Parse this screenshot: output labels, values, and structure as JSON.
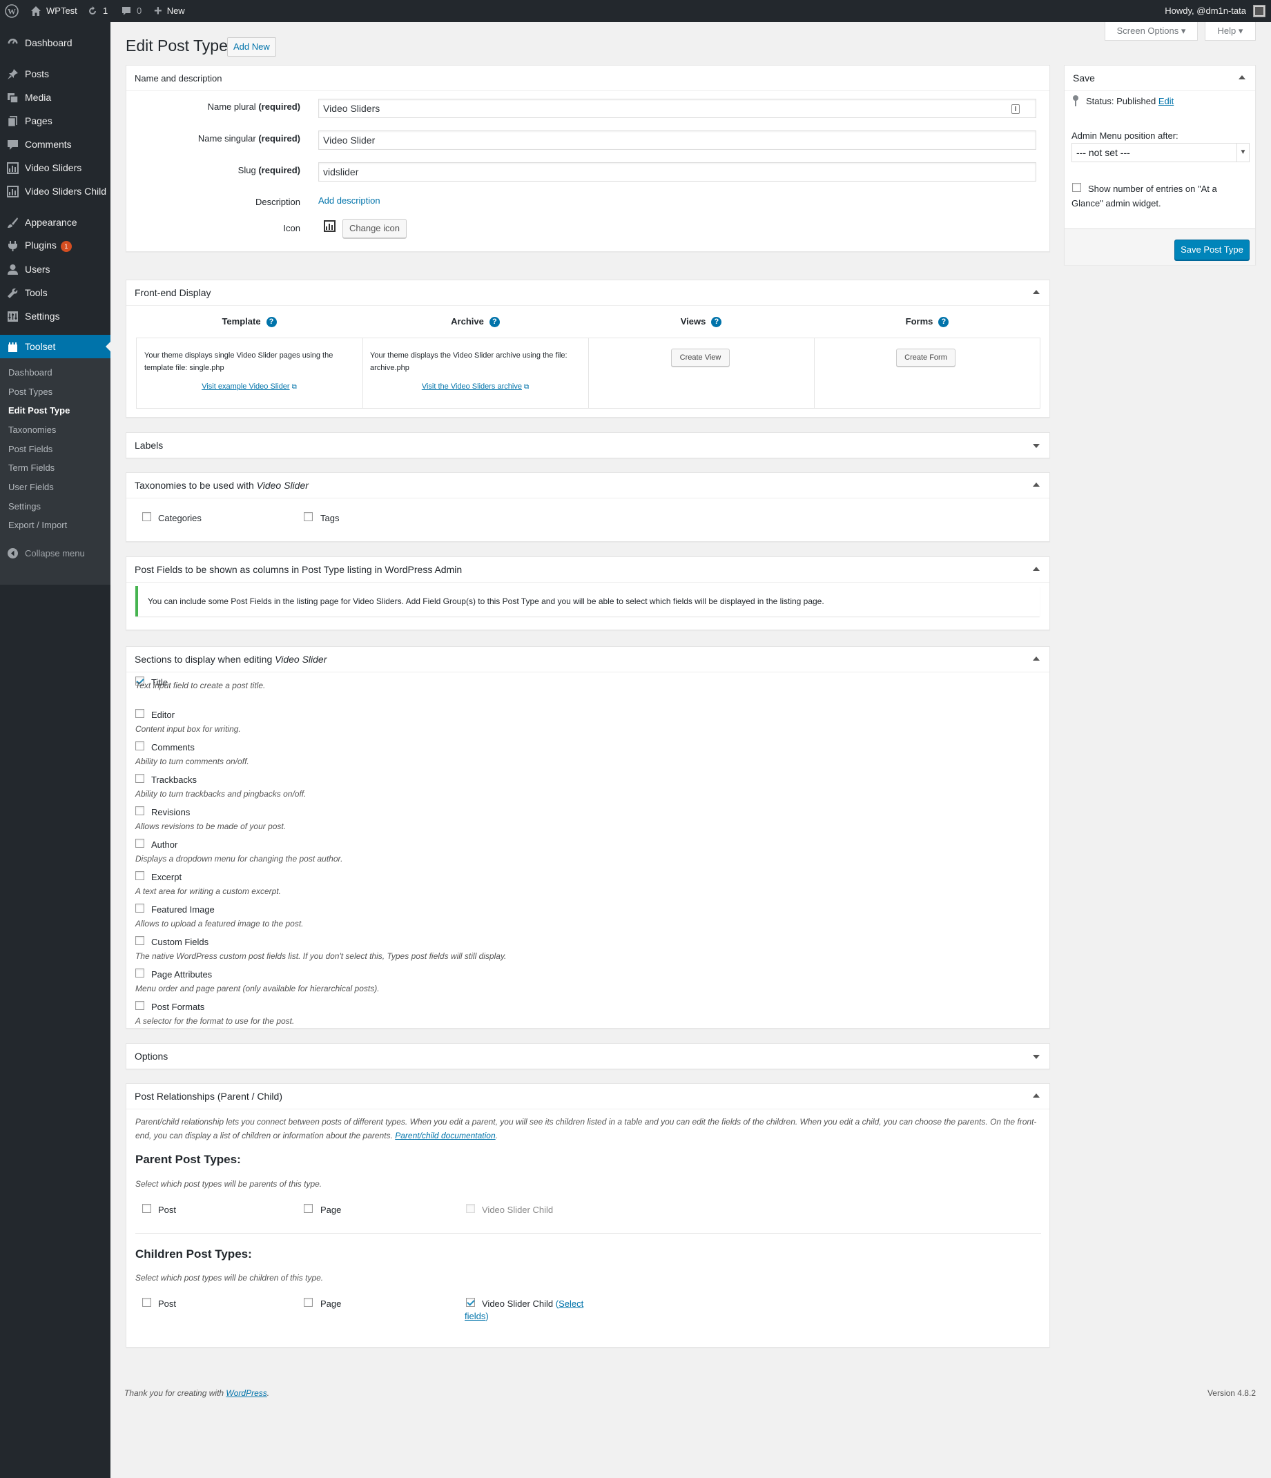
{
  "adminbar": {
    "site_name": "WPTest",
    "updates_count": "1",
    "comments_count": "0",
    "new_label": "New",
    "howdy": "Howdy, @dm1n-tata"
  },
  "sidebar": {
    "items": [
      {
        "label": "Dashboard",
        "icon": "dashboard-icon"
      },
      {
        "label": "Posts",
        "icon": "pin-icon"
      },
      {
        "label": "Media",
        "icon": "media-icon"
      },
      {
        "label": "Pages",
        "icon": "pages-icon"
      },
      {
        "label": "Comments",
        "icon": "comment-icon"
      },
      {
        "label": "Video Sliders",
        "icon": "chart-icon"
      },
      {
        "label": "Video Sliders Child",
        "icon": "chart-icon"
      },
      {
        "label": "Appearance",
        "icon": "brush-icon"
      },
      {
        "label": "Plugins",
        "icon": "plugin-icon",
        "badge": "1"
      },
      {
        "label": "Users",
        "icon": "users-icon"
      },
      {
        "label": "Tools",
        "icon": "wrench-icon"
      },
      {
        "label": "Settings",
        "icon": "settings-icon"
      },
      {
        "label": "Toolset",
        "icon": "toolset-icon"
      }
    ],
    "submenu": [
      "Dashboard",
      "Post Types",
      "Edit Post Type",
      "Taxonomies",
      "Post Fields",
      "Term Fields",
      "User Fields",
      "Settings",
      "Export / Import"
    ],
    "collapse_label": "Collapse menu",
    "accent_color": "#0073aa"
  },
  "header": {
    "title": "Edit Post Type",
    "add_new": "Add New",
    "screen_options": "Screen Options",
    "help": "Help"
  },
  "name_box": {
    "title": "Name and description",
    "plural_label": "Name plural",
    "required": "(required)",
    "plural_value": "Video Sliders",
    "singular_label": "Name singular",
    "singular_value": "Video Slider",
    "slug_label": "Slug",
    "slug_value": "vidslider",
    "description_label": "Description",
    "add_description": "Add description",
    "icon_label": "Icon",
    "change_icon": "Change icon"
  },
  "save_box": {
    "title": "Save",
    "status_label": "Status:",
    "status_value": "Published",
    "edit": "Edit",
    "menu_position_label": "Admin Menu position after:",
    "menu_position_value": "--- not set ---",
    "glance_label": "Show number of entries on \"At a Glance\" admin widget.",
    "save_button": "Save Post Type"
  },
  "frontend": {
    "title": "Front-end Display",
    "cols": [
      {
        "head": "Template",
        "text": "Your theme displays single Video Slider pages using the template file: single.php",
        "link": "Visit example Video Slider"
      },
      {
        "head": "Archive",
        "text": "Your theme displays the Video Slider archive using the file: archive.php",
        "link": "Visit the Video Sliders archive"
      },
      {
        "head": "Views",
        "button": "Create View"
      },
      {
        "head": "Forms",
        "button": "Create Form"
      }
    ]
  },
  "labels_box": {
    "title": "Labels"
  },
  "taxonomies": {
    "title_prefix": "Taxonomies to be used with",
    "title_em": "Video Slider",
    "items": [
      "Categories",
      "Tags"
    ]
  },
  "post_fields": {
    "title": "Post Fields to be shown as columns in Post Type listing in WordPress Admin",
    "notice_a": "You can include some Post Fields in the",
    "notice_b": "listing page for Video Sliders",
    "notice_c": ". Add Field Group(s) to this Post Type and you will be able to select which fields will be displayed in the listing page."
  },
  "sections": {
    "title_prefix": "Sections to display when editing",
    "title_em": "Video Slider",
    "items": [
      {
        "label": "Title",
        "desc": "Text input field to create a post title.",
        "checked": true
      },
      {
        "label": "Editor",
        "desc": "Content input box for writing.",
        "checked": false
      },
      {
        "label": "Comments",
        "desc": "Ability to turn comments on/off.",
        "checked": false
      },
      {
        "label": "Trackbacks",
        "desc": "Ability to turn trackbacks and pingbacks on/off.",
        "checked": false
      },
      {
        "label": "Revisions",
        "desc": "Allows revisions to be made of your post.",
        "checked": false
      },
      {
        "label": "Author",
        "desc": "Displays a dropdown menu for changing the post author.",
        "checked": false
      },
      {
        "label": "Excerpt",
        "desc": "A text area for writing a custom excerpt.",
        "checked": false
      },
      {
        "label": "Featured Image",
        "desc": "Allows to upload a featured image to the post.",
        "checked": false
      },
      {
        "label": "Custom Fields",
        "desc": "The native WordPress custom post fields list. If you don't select this, Types post fields will still display.",
        "checked": false
      },
      {
        "label": "Page Attributes",
        "desc": "Menu order and page parent (only available for hierarchical posts).",
        "checked": false
      },
      {
        "label": "Post Formats",
        "desc": "A selector for the format to use for the post.",
        "checked": false
      }
    ]
  },
  "options_box": {
    "title": "Options"
  },
  "relationships": {
    "title": "Post Relationships (Parent / Child)",
    "intro": "Parent/child relationship lets you connect between posts of different types. When you edit a parent, you will see its children listed in a table and you can edit the fields of the children. When you edit a child, you can choose the parents. On the front-end, you can display a list of children or information about the parents.",
    "doc_link": "Parent/child documentation",
    "parent_heading": "Parent Post Types:",
    "parent_desc": "Select which post types will be parents of this type.",
    "parent_items": [
      "Post",
      "Page",
      "Video Slider Child"
    ],
    "children_heading": "Children Post Types:",
    "children_desc": "Select which post types will be children of this type.",
    "children_items": [
      "Post",
      "Page",
      "Video Slider Child"
    ],
    "select_a": "Select",
    "select_b": "fields"
  },
  "footer": {
    "thanks": "Thank you for creating with",
    "wp_link": "WordPress",
    "version": "Version 4.8.2"
  }
}
